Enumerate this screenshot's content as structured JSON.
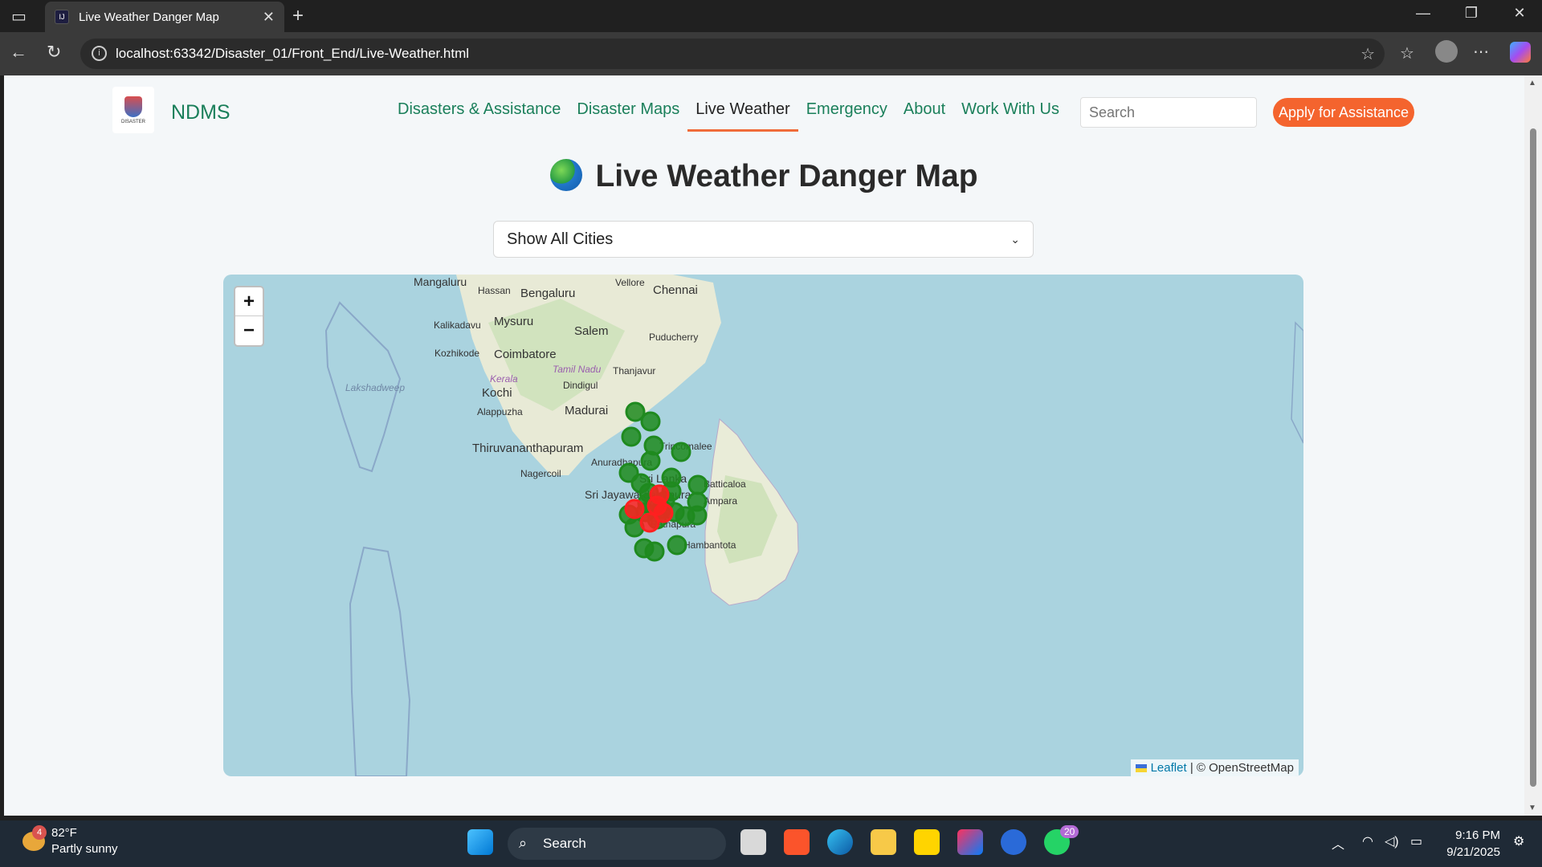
{
  "browser": {
    "tab_title": "Live Weather Danger Map",
    "url": "localhost:63342/Disaster_01/Front_End/Live-Weather.html"
  },
  "site": {
    "brand": "NDMS",
    "logo_text": "DISASTER",
    "nav": [
      {
        "label": "Disasters & Assistance",
        "active": false
      },
      {
        "label": "Disaster Maps",
        "active": false
      },
      {
        "label": "Live Weather",
        "active": true
      },
      {
        "label": "Emergency",
        "active": false
      },
      {
        "label": "About",
        "active": false
      },
      {
        "label": "Work With Us",
        "active": false
      }
    ],
    "search_placeholder": "Search",
    "apply_label": "Apply for Assistance",
    "accent_color": "#f4642e",
    "brand_color": "#1a7f5a"
  },
  "page": {
    "title": "Live Weather Danger Map",
    "select_value": "Show All Cities"
  },
  "map": {
    "zoom_in": "+",
    "zoom_out": "−",
    "attribution_leaflet": "Leaflet",
    "attribution_rest": "| © OpenStreetMap",
    "place_labels": [
      "Mangaluru",
      "Hassan",
      "Bengaluru",
      "Vellore",
      "Chennai",
      "Kalikadavu",
      "Mysuru",
      "Salem",
      "Puducherry",
      "Kozhikode",
      "Coimbatore",
      "Tamil Nadu",
      "Thanjavur",
      "Lakshadweep",
      "Kerala",
      "Dindigul",
      "Kochi",
      "Alappuzha",
      "Madurai",
      "Thiruvananthapuram",
      "Nagercoil",
      "Anuradhapura",
      "Sri Lanka",
      "Sri Jayawardenepura",
      "Batticaloa",
      "Ampara",
      "Ratnapura",
      "Hambantota",
      "Trincomalee"
    ],
    "marker_colors": {
      "safe": "#1f8a1f",
      "danger": "#ff2020"
    },
    "markers_safe": 26,
    "markers_danger": 5
  },
  "taskbar": {
    "weather_temp": "82°F",
    "weather_desc": "Partly sunny",
    "weather_badge": "4",
    "search": "Search",
    "whatsapp_badge": "20",
    "time": "9:16 PM",
    "date": "9/21/2025"
  }
}
